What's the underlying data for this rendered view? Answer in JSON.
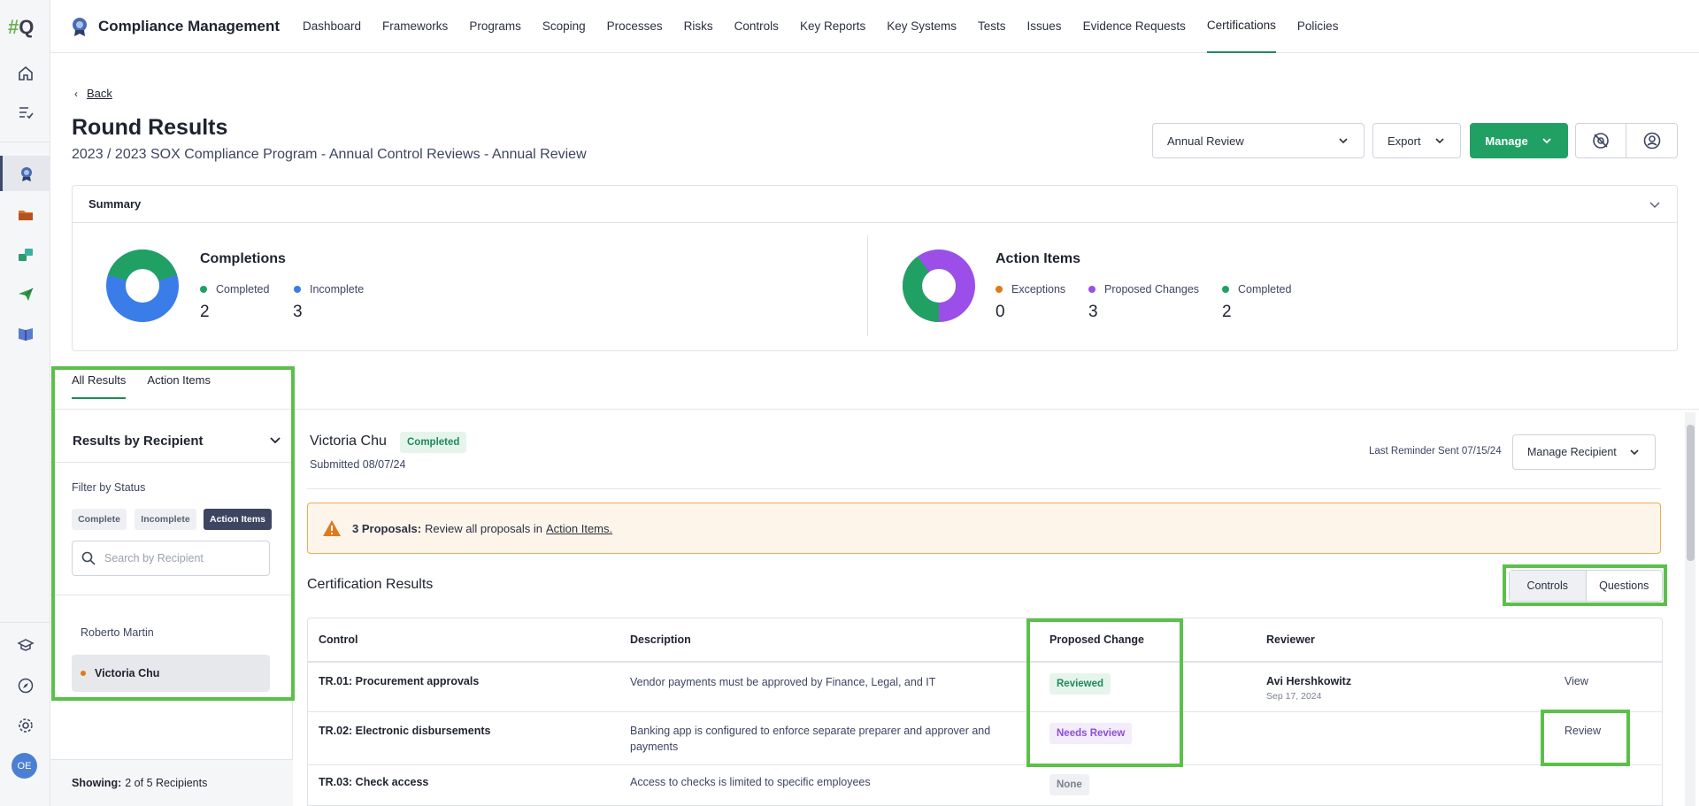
{
  "app": {
    "logo": "#Q",
    "title": "Compliance Management",
    "avatar_initials": "OE"
  },
  "nav": {
    "items": [
      "Dashboard",
      "Frameworks",
      "Programs",
      "Scoping",
      "Processes",
      "Risks",
      "Controls",
      "Key Reports",
      "Key Systems",
      "Tests",
      "Issues",
      "Evidence Requests",
      "Certifications",
      "Policies"
    ],
    "active": "Certifications"
  },
  "header": {
    "back_label": "Back",
    "title": "Round Results",
    "subtitle": "2023 / 2023 SOX Compliance Program - Annual Control Reviews - Annual Review",
    "review_select": "Annual Review",
    "export_label": "Export",
    "manage_label": "Manage"
  },
  "summary": {
    "title": "Summary",
    "completions": {
      "title": "Completions",
      "legend": [
        {
          "label": "Completed",
          "value": "2",
          "color": "#20a163"
        },
        {
          "label": "Incomplete",
          "value": "3",
          "color": "#3b7de8"
        }
      ]
    },
    "action_items": {
      "title": "Action Items",
      "legend": [
        {
          "label": "Exceptions",
          "value": "0",
          "color": "#e07a1c"
        },
        {
          "label": "Proposed Changes",
          "value": "3",
          "color": "#9b4fe8"
        },
        {
          "label": "Completed",
          "value": "2",
          "color": "#20a163"
        }
      ]
    }
  },
  "tabs": {
    "all_results": "All Results",
    "action_items": "Action Items"
  },
  "left_panel": {
    "heading": "Results by Recipient",
    "filter_label": "Filter by Status",
    "chips": [
      "Complete",
      "Incomplete",
      "Action Items"
    ],
    "active_chip": "Action Items",
    "search_placeholder": "Search by Recipient",
    "recipients": [
      "Roberto Martin",
      "Victoria Chu"
    ],
    "footer_bold": "Showing:",
    "footer_text": "2 of 5 Recipients"
  },
  "recipient": {
    "name": "Victoria Chu",
    "status": "Completed",
    "submitted": "Submitted 08/07/24",
    "last_reminder": "Last Reminder Sent 07/15/24",
    "manage_label": "Manage Recipient"
  },
  "alert": {
    "bold": "3 Proposals:",
    "text": "Review all proposals in",
    "link": "Action Items."
  },
  "results": {
    "title": "Certification Results",
    "toggle": [
      "Controls",
      "Questions"
    ],
    "columns": [
      "Control",
      "Description",
      "Proposed Change",
      "Reviewer"
    ],
    "rows": [
      {
        "control": "TR.01: Procurement approvals",
        "description": "Vendor payments must be approved by Finance, Legal, and IT",
        "status": "Reviewed",
        "reviewer": "Avi Hershkowitz",
        "reviewer_date": "Sep 17, 2024",
        "action": "View"
      },
      {
        "control": "TR.02: Electronic disbursements",
        "description": "Banking app is configured to enforce separate preparer and approver and payments",
        "status": "Needs Review",
        "reviewer": "",
        "reviewer_date": "",
        "action": "Review"
      },
      {
        "control": "TR.03: Check access",
        "description": "Access to checks is limited to specific employees",
        "status": "None",
        "reviewer": "",
        "reviewer_date": "",
        "action": ""
      }
    ]
  },
  "colors": {
    "brand_green": "#20a163",
    "highlight_green": "#5bc04a",
    "incomplete_blue": "#3b7de8",
    "proposed_purple": "#9b4fe8"
  }
}
